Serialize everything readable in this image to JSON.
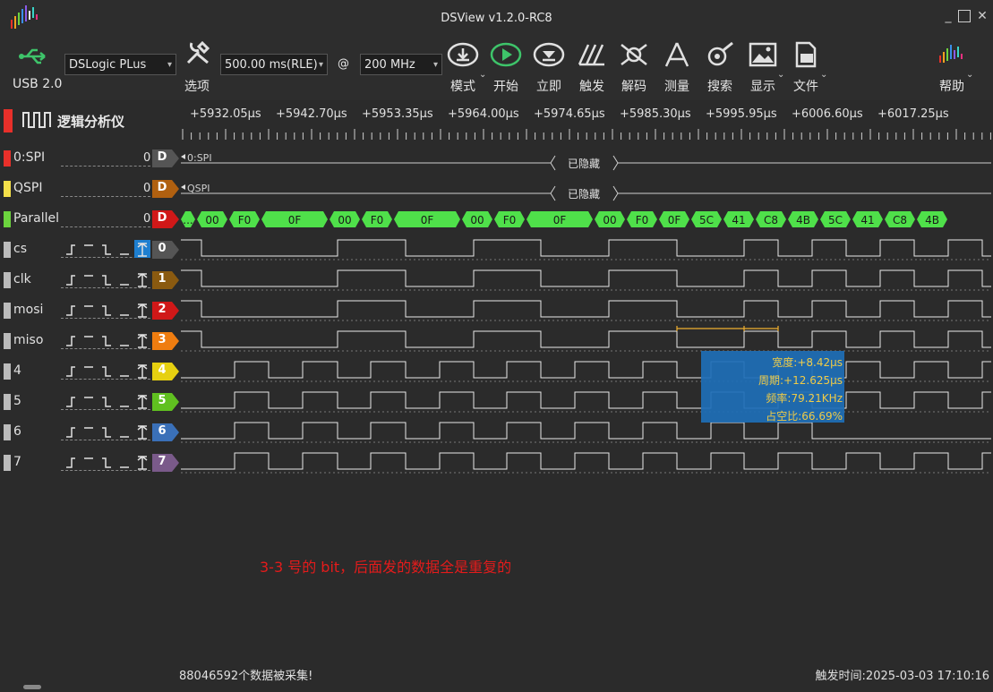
{
  "window": {
    "title": "DSView v1.2.0-RC8"
  },
  "toolbar": {
    "usb_label": "USB 2.0",
    "device": "DSLogic PLus",
    "options_label": "选项",
    "duration": "500.00 ms(RLE)",
    "at": "@",
    "rate": "200 MHz",
    "buttons": [
      {
        "label": "模式",
        "icon": "mode-icon"
      },
      {
        "label": "开始",
        "icon": "play-icon"
      },
      {
        "label": "立即",
        "icon": "instant-icon"
      },
      {
        "label": "触发",
        "icon": "trigger-icon"
      },
      {
        "label": "解码",
        "icon": "decode-icon"
      },
      {
        "label": "测量",
        "icon": "measure-icon"
      },
      {
        "label": "搜索",
        "icon": "search-icon"
      },
      {
        "label": "显示",
        "icon": "display-icon"
      },
      {
        "label": "文件",
        "icon": "file-icon"
      }
    ],
    "help_label": "帮助"
  },
  "header": {
    "title": "逻辑分析仪"
  },
  "ruler": {
    "ticks": [
      "+5932.05µs",
      "+5942.70µs",
      "+5953.35µs",
      "+5964.00µs",
      "+5974.65µs",
      "+5985.30µs",
      "+5995.95µs",
      "+6006.60µs",
      "+6017.25µs"
    ]
  },
  "channels": [
    {
      "name": "0:SPI",
      "num": "0",
      "tag": "D",
      "color": "#e8302a",
      "tagColor": "#555555",
      "kind": "decoder"
    },
    {
      "name": "QSPI",
      "num": "0",
      "tag": "D",
      "color": "#f5e04a",
      "tagColor": "#b06010",
      "kind": "decoder"
    },
    {
      "name": "Parallel",
      "num": "0",
      "tag": "D",
      "color": "#6cd43e",
      "tagColor": "#d01818",
      "kind": "decoder"
    },
    {
      "name": "cs",
      "num": "",
      "tag": "0",
      "color": "#bbbbbb",
      "tagColor": "#555555",
      "kind": "logic"
    },
    {
      "name": "clk",
      "num": "",
      "tag": "1",
      "color": "#bbbbbb",
      "tagColor": "#8a5a10",
      "kind": "logic"
    },
    {
      "name": "mosi",
      "num": "",
      "tag": "2",
      "color": "#bbbbbb",
      "tagColor": "#d01818",
      "kind": "logic"
    },
    {
      "name": "miso",
      "num": "",
      "tag": "3",
      "color": "#bbbbbb",
      "tagColor": "#ef7d10",
      "kind": "logic"
    },
    {
      "name": "4",
      "num": "",
      "tag": "4",
      "color": "#bbbbbb",
      "tagColor": "#e6d010",
      "kind": "logic"
    },
    {
      "name": "5",
      "num": "",
      "tag": "5",
      "color": "#bbbbbb",
      "tagColor": "#60c020",
      "kind": "logic"
    },
    {
      "name": "6",
      "num": "",
      "tag": "6",
      "color": "#bbbbbb",
      "tagColor": "#3a70b8",
      "kind": "logic"
    },
    {
      "name": "7",
      "num": "",
      "tag": "7",
      "color": "#bbbbbb",
      "tagColor": "#7a5a8a",
      "kind": "logic"
    }
  ],
  "decoder_rows": {
    "spi_label": "0:SPI",
    "qspi_label": "QSPI",
    "hidden": "已隐藏"
  },
  "parallel_values": [
    "...",
    "00",
    "F0",
    "0F",
    "00",
    "F0",
    "0F",
    "00",
    "F0",
    "0F",
    "00",
    "F0",
    "0F",
    "5C",
    "41",
    "C8",
    "4B",
    "5C",
    "41",
    "C8",
    "4B"
  ],
  "measurement": {
    "width": "宽度:+8.42µs",
    "period": "周期:+12.625µs",
    "freq": "频率:79.21KHz",
    "duty": "占空比:66.69%"
  },
  "annotation": "3-3 号的 bit，后面发的数据全是重复的",
  "status": {
    "captured": "88046592个数据被采集!",
    "trigger_time": "触发时间:2025-03-03 17:10:16"
  }
}
